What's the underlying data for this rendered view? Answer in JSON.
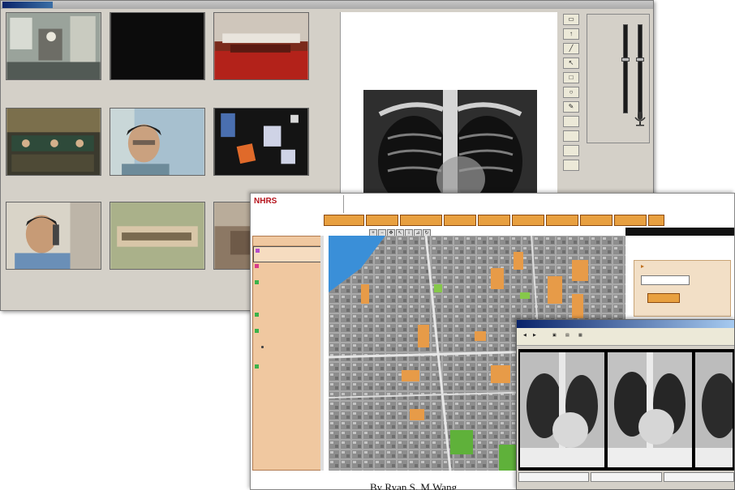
{
  "window1": {
    "title_tab": "",
    "video_feeds": [
      {
        "caption": "",
        "sub": ""
      },
      {
        "caption": "",
        "sub": ""
      },
      {
        "caption": "",
        "sub": ""
      },
      {
        "caption": "",
        "sub": ""
      },
      {
        "caption": "",
        "sub": ""
      },
      {
        "caption": "",
        "sub": ""
      },
      {
        "caption": "",
        "sub": ""
      },
      {
        "caption": "",
        "sub": ""
      },
      {
        "caption": "",
        "sub": ""
      }
    ],
    "status": "",
    "tool_icons": [
      "open-icon",
      "arrow-up-icon",
      "line-icon",
      "pointer-icon",
      "rectangle-icon",
      "ellipse-icon",
      "pen-icon"
    ],
    "levels_text": ""
  },
  "window2": {
    "logo_latin": "NHRS",
    "logo_cjk": "",
    "user_info": "",
    "nav_buttons": [
      "",
      "",
      "",
      "",
      "",
      "",
      "",
      "",
      "",
      "",
      ""
    ],
    "sidebar_title": "",
    "sidebar_items": [
      "",
      "",
      "",
      "",
      "",
      "",
      "",
      "",
      ""
    ],
    "query_panel_title": "",
    "query_subtitle": "",
    "query_input": "",
    "query_button": "",
    "status": ""
  },
  "window3": {
    "title": "",
    "toolbar_labels": [
      "",
      "",
      ""
    ],
    "image_captions": [
      "",
      "",
      ""
    ]
  },
  "slide": {
    "org_line1": "",
    "org_line2": "",
    "byline": "By Ryan S. M.Wang"
  },
  "colors": {
    "nav_orange": "#e8a040",
    "sidebar_peach": "#f0c8a0",
    "logo_red": "#b5121b",
    "window_gray": "#d4d0c8"
  }
}
